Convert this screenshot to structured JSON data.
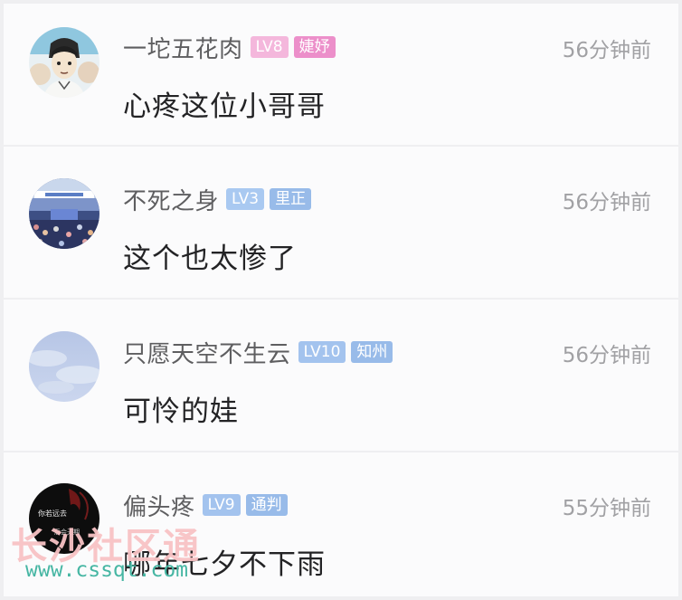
{
  "comments": [
    {
      "username": "一坨五花肉",
      "level": "LV8",
      "level_color": "#f4b7dc",
      "title_badge": "婕妤",
      "title_color": "#ec8fca",
      "time": "56分钟前",
      "text": "心疼这位小哥哥",
      "avatar_icon": "anime-boy-avatar-icon"
    },
    {
      "username": "不死之身",
      "level": "LV3",
      "level_color": "#a9c9f1",
      "title_badge": "里正",
      "title_color": "#98bbe9",
      "time": "56分钟前",
      "text": "这个也太惨了",
      "avatar_icon": "stadium-crowd-avatar-icon"
    },
    {
      "username": "只愿天空不生云",
      "level": "LV10",
      "level_color": "#a3c3ee",
      "title_badge": "知州",
      "title_color": "#98bbe9",
      "time": "56分钟前",
      "text": "可怜的娃",
      "avatar_icon": "sky-avatar-icon"
    },
    {
      "username": "偏头疼",
      "level": "LV9",
      "level_color": "#a3c3ee",
      "title_badge": "通判",
      "title_color": "#98bbe9",
      "time": "55分钟前",
      "text": "哪年七夕不下雨",
      "avatar_icon": "dark-text-avatar-icon"
    }
  ],
  "avatar_texts": {
    "line1": "你若远去",
    "line2": "后会无期"
  },
  "watermark": {
    "name": "长沙社区通",
    "url": "www.cssqt.com"
  }
}
